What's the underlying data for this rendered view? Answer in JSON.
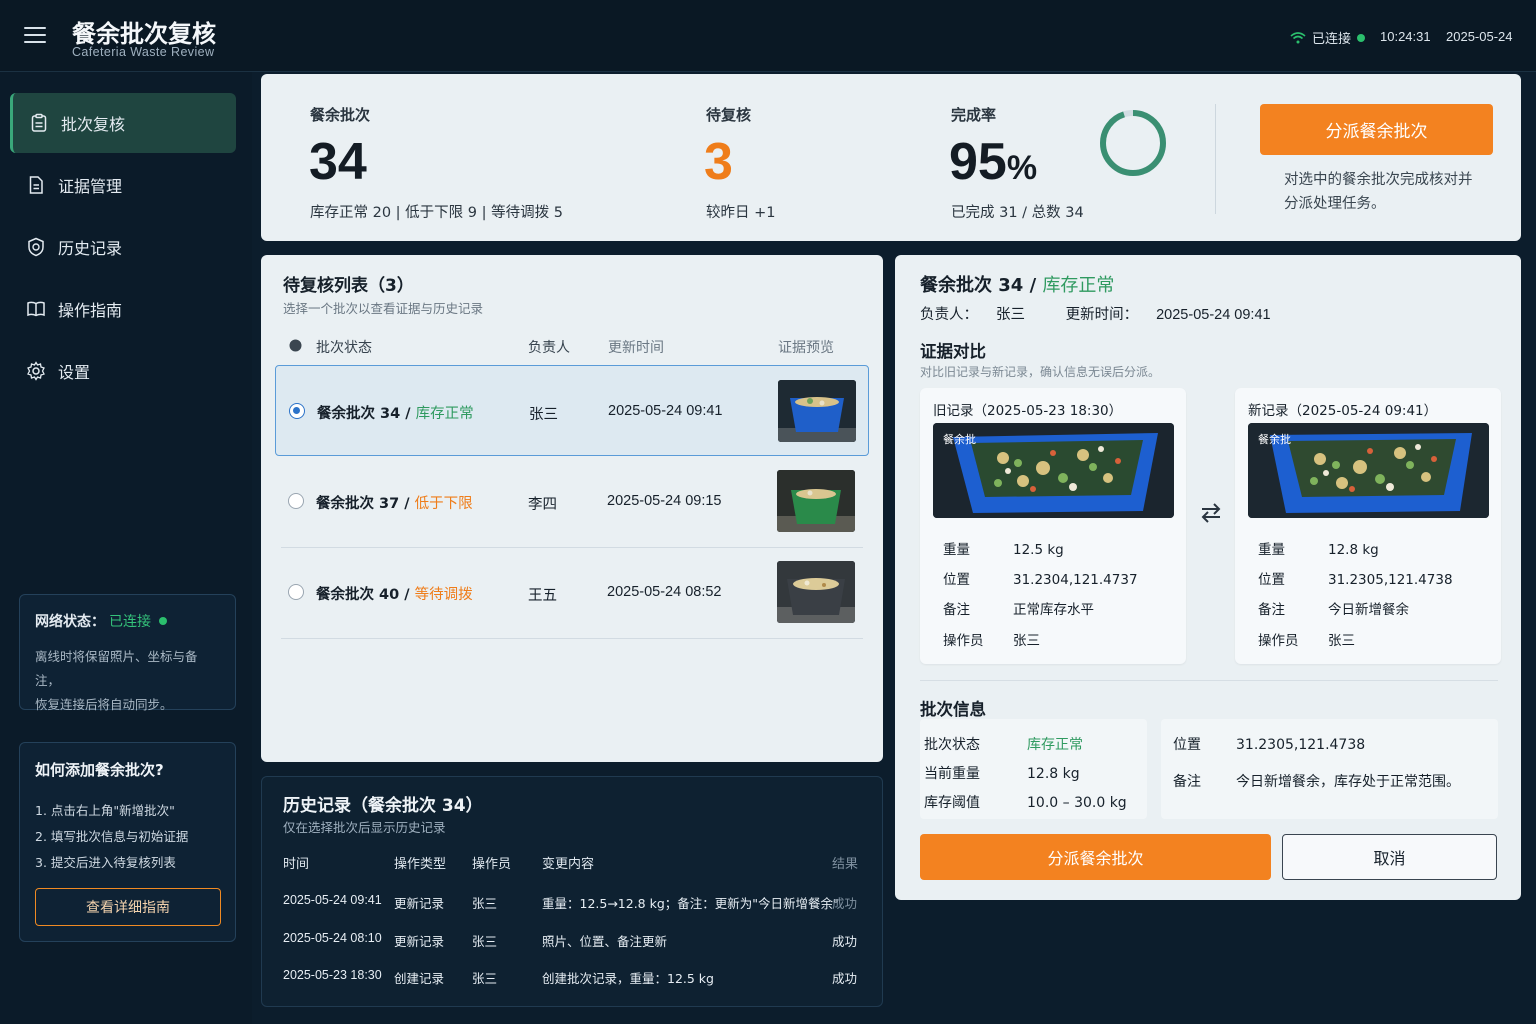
{
  "header": {
    "title": "餐余批次复核",
    "subtitle": "Cafeteria Waste Review",
    "connection": "已连接",
    "time": "10:24:31",
    "date": "2025-05-24"
  },
  "sidebar": {
    "items": [
      {
        "label": "批次复核",
        "icon": "clipboard-icon",
        "active": true
      },
      {
        "label": "证据管理",
        "icon": "document-icon",
        "active": false
      },
      {
        "label": "历史记录",
        "icon": "shield-clock-icon",
        "active": false
      },
      {
        "label": "操作指南",
        "icon": "book-icon",
        "active": false
      },
      {
        "label": "设置",
        "icon": "gear-icon",
        "active": false
      }
    ],
    "network": {
      "label": "网络状态：",
      "value": "已连接",
      "desc_line1": "离线时将保留照片、坐标与备注，",
      "desc_line2": "恢复连接后将自动同步。"
    },
    "guide": {
      "title": "如何添加餐余批次?",
      "steps": [
        "1. 点击右上角\"新增批次\"",
        "2. 填写批次信息与初始证据",
        "3. 提交后进入待复核列表"
      ],
      "button": "查看详细指南"
    }
  },
  "stats": {
    "batches": {
      "label": "餐余批次",
      "value": "34",
      "sub": "库存正常 20 | 低于下限 9 | 等待调拨 5"
    },
    "pending": {
      "label": "待复核",
      "value": "3",
      "sub": "较昨日 +1"
    },
    "completion": {
      "label": "完成率",
      "value": "95",
      "unit": "%",
      "sub": "已完成 31 / 总数 34",
      "fraction": 0.95
    },
    "dispatch_button": "分派餐余批次",
    "dispatch_desc": "对选中的餐余批次完成核对并分派处理任务。"
  },
  "pending_list": {
    "title": "待复核列表（3）",
    "subtitle": "选择一个批次以查看证据与历史记录",
    "columns": [
      "批次状态",
      "负责人",
      "更新时间",
      "证据预览"
    ],
    "rows": [
      {
        "name": "餐余批次 34",
        "sep": " / ",
        "status": "库存正常",
        "owner": "张三",
        "time": "2025-05-24 09:41",
        "selected": true,
        "bin_color": "#1f5fc9"
      },
      {
        "name": "餐余批次 37",
        "sep": " / ",
        "status": "低于下限",
        "owner": "李四",
        "time": "2025-05-24 09:15",
        "selected": false,
        "bin_color": "#2a8a4a"
      },
      {
        "name": "餐余批次 40",
        "sep": " / ",
        "status": "等待调拨",
        "owner": "王五",
        "time": "2025-05-24 08:52",
        "selected": false,
        "bin_color": "#3a3f45"
      }
    ]
  },
  "history": {
    "title": "历史记录（餐余批次 34）",
    "subtitle": "仅在选择批次后显示历史记录",
    "columns": [
      "时间",
      "操作类型",
      "操作员",
      "变更内容",
      "结果"
    ],
    "rows": [
      {
        "time": "2025-05-24 09:41",
        "type": "更新记录",
        "operator": "张三",
        "change": "重量：12.5→12.8 kg；备注：更新为\"今日新增餐余\"",
        "result": "成功"
      },
      {
        "time": "2025-05-24 08:10",
        "type": "更新记录",
        "operator": "张三",
        "change": "照片、位置、备注更新",
        "result": "成功"
      },
      {
        "time": "2025-05-23 18:30",
        "type": "创建记录",
        "operator": "张三",
        "change": "创建批次记录，重量：12.5 kg",
        "result": "成功"
      }
    ]
  },
  "detail": {
    "title": "餐余批次 34 / ",
    "status": "库存正常",
    "owner_label": "负责人：",
    "owner": "张三",
    "updated_label": "更新时间：",
    "updated": "2025-05-24 09:41",
    "evidence_title": "证据对比",
    "evidence_sub": "对比旧记录与新记录，确认信息无误后分派。",
    "old_record": {
      "title": "旧记录（2025-05-23 18:30）",
      "photo_tag": "餐余批",
      "fields": [
        {
          "k": "重量",
          "v": "12.5 kg"
        },
        {
          "k": "位置",
          "v": "31.2304,121.4737"
        },
        {
          "k": "备注",
          "v": "正常库存水平"
        },
        {
          "k": "操作员",
          "v": "张三"
        }
      ]
    },
    "new_record": {
      "title": "新记录（2025-05-24 09:41）",
      "photo_tag": "餐余批",
      "fields": [
        {
          "k": "重量",
          "v": "12.8 kg"
        },
        {
          "k": "位置",
          "v": "31.2305,121.4738"
        },
        {
          "k": "备注",
          "v": "今日新增餐余"
        },
        {
          "k": "操作员",
          "v": "张三"
        }
      ]
    },
    "batch_info_title": "批次信息",
    "batch_info": {
      "status_label": "批次状态",
      "status": "库存正常",
      "weight_label": "当前重量",
      "weight": "12.8 kg",
      "threshold_label": "库存阈值",
      "threshold": "10.0 – 30.0 kg",
      "location_label": "位置",
      "location": "31.2305,121.4738",
      "note_label": "备注",
      "note": "今日新增餐余，库存处于正常范围。"
    },
    "dispatch_button": "分派餐余批次",
    "cancel_button": "取消"
  },
  "colors": {
    "accent_orange": "#f38220",
    "status_green": "#2f9a60",
    "status_orange": "#ef7d1a",
    "donut_green": "#3a8f72"
  }
}
